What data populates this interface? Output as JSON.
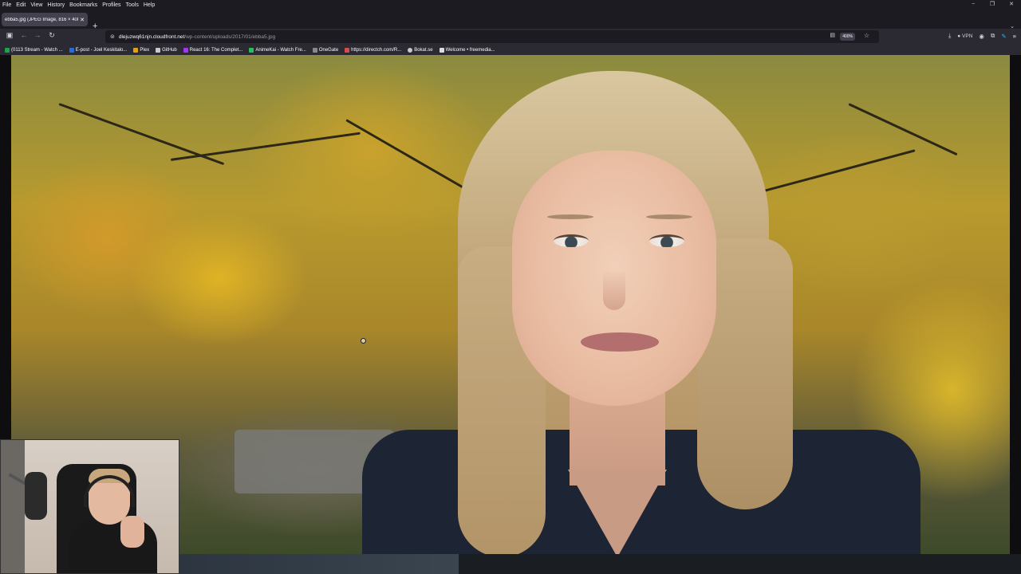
{
  "menu": [
    "File",
    "Edit",
    "View",
    "History",
    "Bookmarks",
    "Profiles",
    "Tools",
    "Help"
  ],
  "window_controls": {
    "minimize": "−",
    "maximize": "❐",
    "close": "✕"
  },
  "tab": {
    "title": "ebba5.jpg (JPEG Image, 816 × 408 p...",
    "close": "✕"
  },
  "new_tab": "+",
  "tab_list": "⌄",
  "nav": {
    "back": "←",
    "forward": "→",
    "reload": "↻",
    "sidebar": "▣"
  },
  "url": {
    "host": "dlejuzwq61njn.cloudfront.net",
    "path": "/wp-content/uploads/2017/01/ebba5.jpg",
    "zoom": "400%"
  },
  "toolbar_right": {
    "download": "⤓",
    "vpn": "VPN",
    "account": "◉",
    "extensions": "⧉",
    "addon": "✎",
    "menu": "≡"
  },
  "bookmarks": [
    {
      "label": "(0113 Stream - Watch ...",
      "color": "#19a34a"
    },
    {
      "label": "E-post - Joel Keskitalo...",
      "color": "#2a6bd8"
    },
    {
      "label": "Plex",
      "color": "#e5a00d"
    },
    {
      "label": "GitHub",
      "color": "#c9c9c9"
    },
    {
      "label": "React 16: The Complet...",
      "color": "#a435f0"
    },
    {
      "label": "AnimeKai - Watch Fre...",
      "color": "#2bbd5a"
    },
    {
      "label": "OneGate",
      "color": "#888888"
    },
    {
      "label": "https://directch.com/R...",
      "color": "#d94a4a"
    },
    {
      "label": "Bokat.se",
      "color": "#c9c9c9"
    },
    {
      "label": "Welcome • freemedia...",
      "color": "#dddddd"
    }
  ],
  "icons": {
    "lock": "lock-icon",
    "reader": "reader-view-icon",
    "star": "bookmark-star-icon",
    "zoom_cursor": "zoom-in-cursor-icon"
  }
}
